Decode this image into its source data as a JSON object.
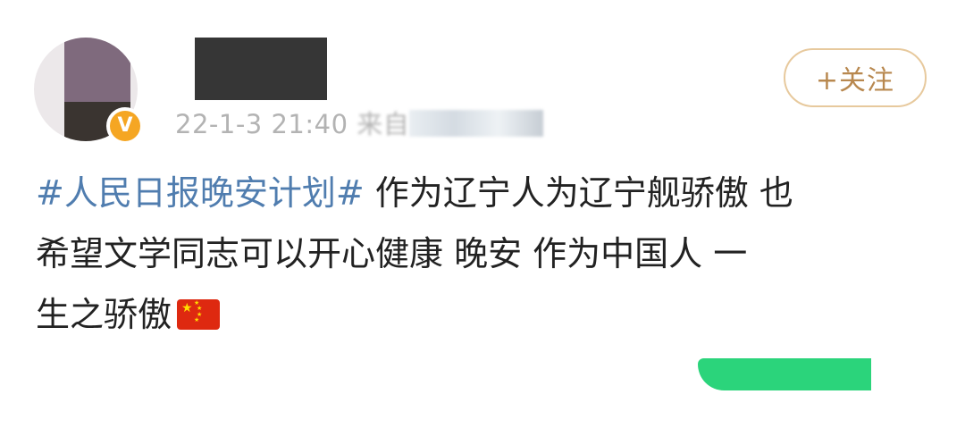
{
  "post": {
    "timestamp": "22-1-3 21:40",
    "source_prefix": "来自",
    "follow_label": "+关注",
    "hashtag": "#人民日报晚安计划#",
    "text_line1": " 作为辽宁人为辽宁舰骄傲 也",
    "text_line2": "希望文学同志可以开心健康   晚安  作为中国人 一",
    "text_line3": "生之骄傲"
  },
  "badge": {
    "verified_glyph": "V"
  },
  "colors": {
    "hashtag": "#507daf",
    "follow_border": "#e7c99d",
    "follow_text": "#b8884f",
    "verified_badge": "#f5a623",
    "meta_text": "#b3b3b3",
    "action_green": "#2bd47b"
  },
  "icons": {
    "avatar": "avatar-image",
    "verified": "verified-v-icon",
    "flag": "china-flag-emoji"
  }
}
